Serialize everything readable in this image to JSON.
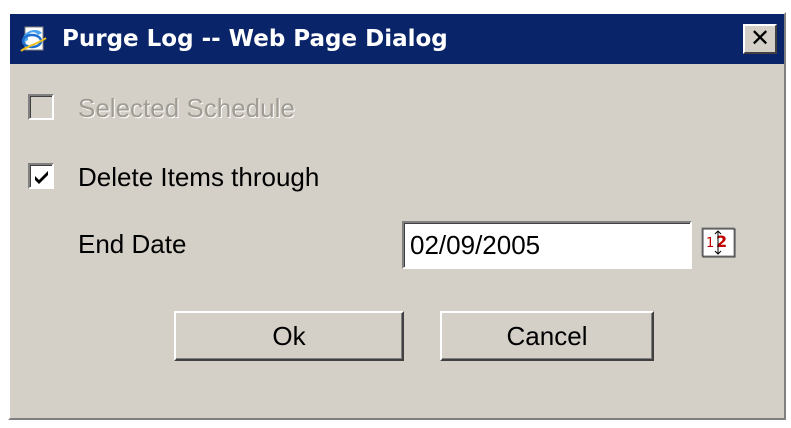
{
  "window": {
    "title": "Purge Log -- Web Page Dialog",
    "close_glyph": "✕",
    "titlebar_color": "#0a246a",
    "face_color": "#d4d0c8"
  },
  "options": {
    "selected_schedule": {
      "label": "Selected Schedule",
      "checked": false,
      "disabled": true
    },
    "delete_items": {
      "label": "Delete Items through",
      "checked": true,
      "disabled": false
    }
  },
  "end_date": {
    "label": "End Date",
    "value": "02/09/2005",
    "calendar_icon": "calendar-icon"
  },
  "buttons": {
    "ok_label": "Ok",
    "cancel_label": "Cancel"
  }
}
